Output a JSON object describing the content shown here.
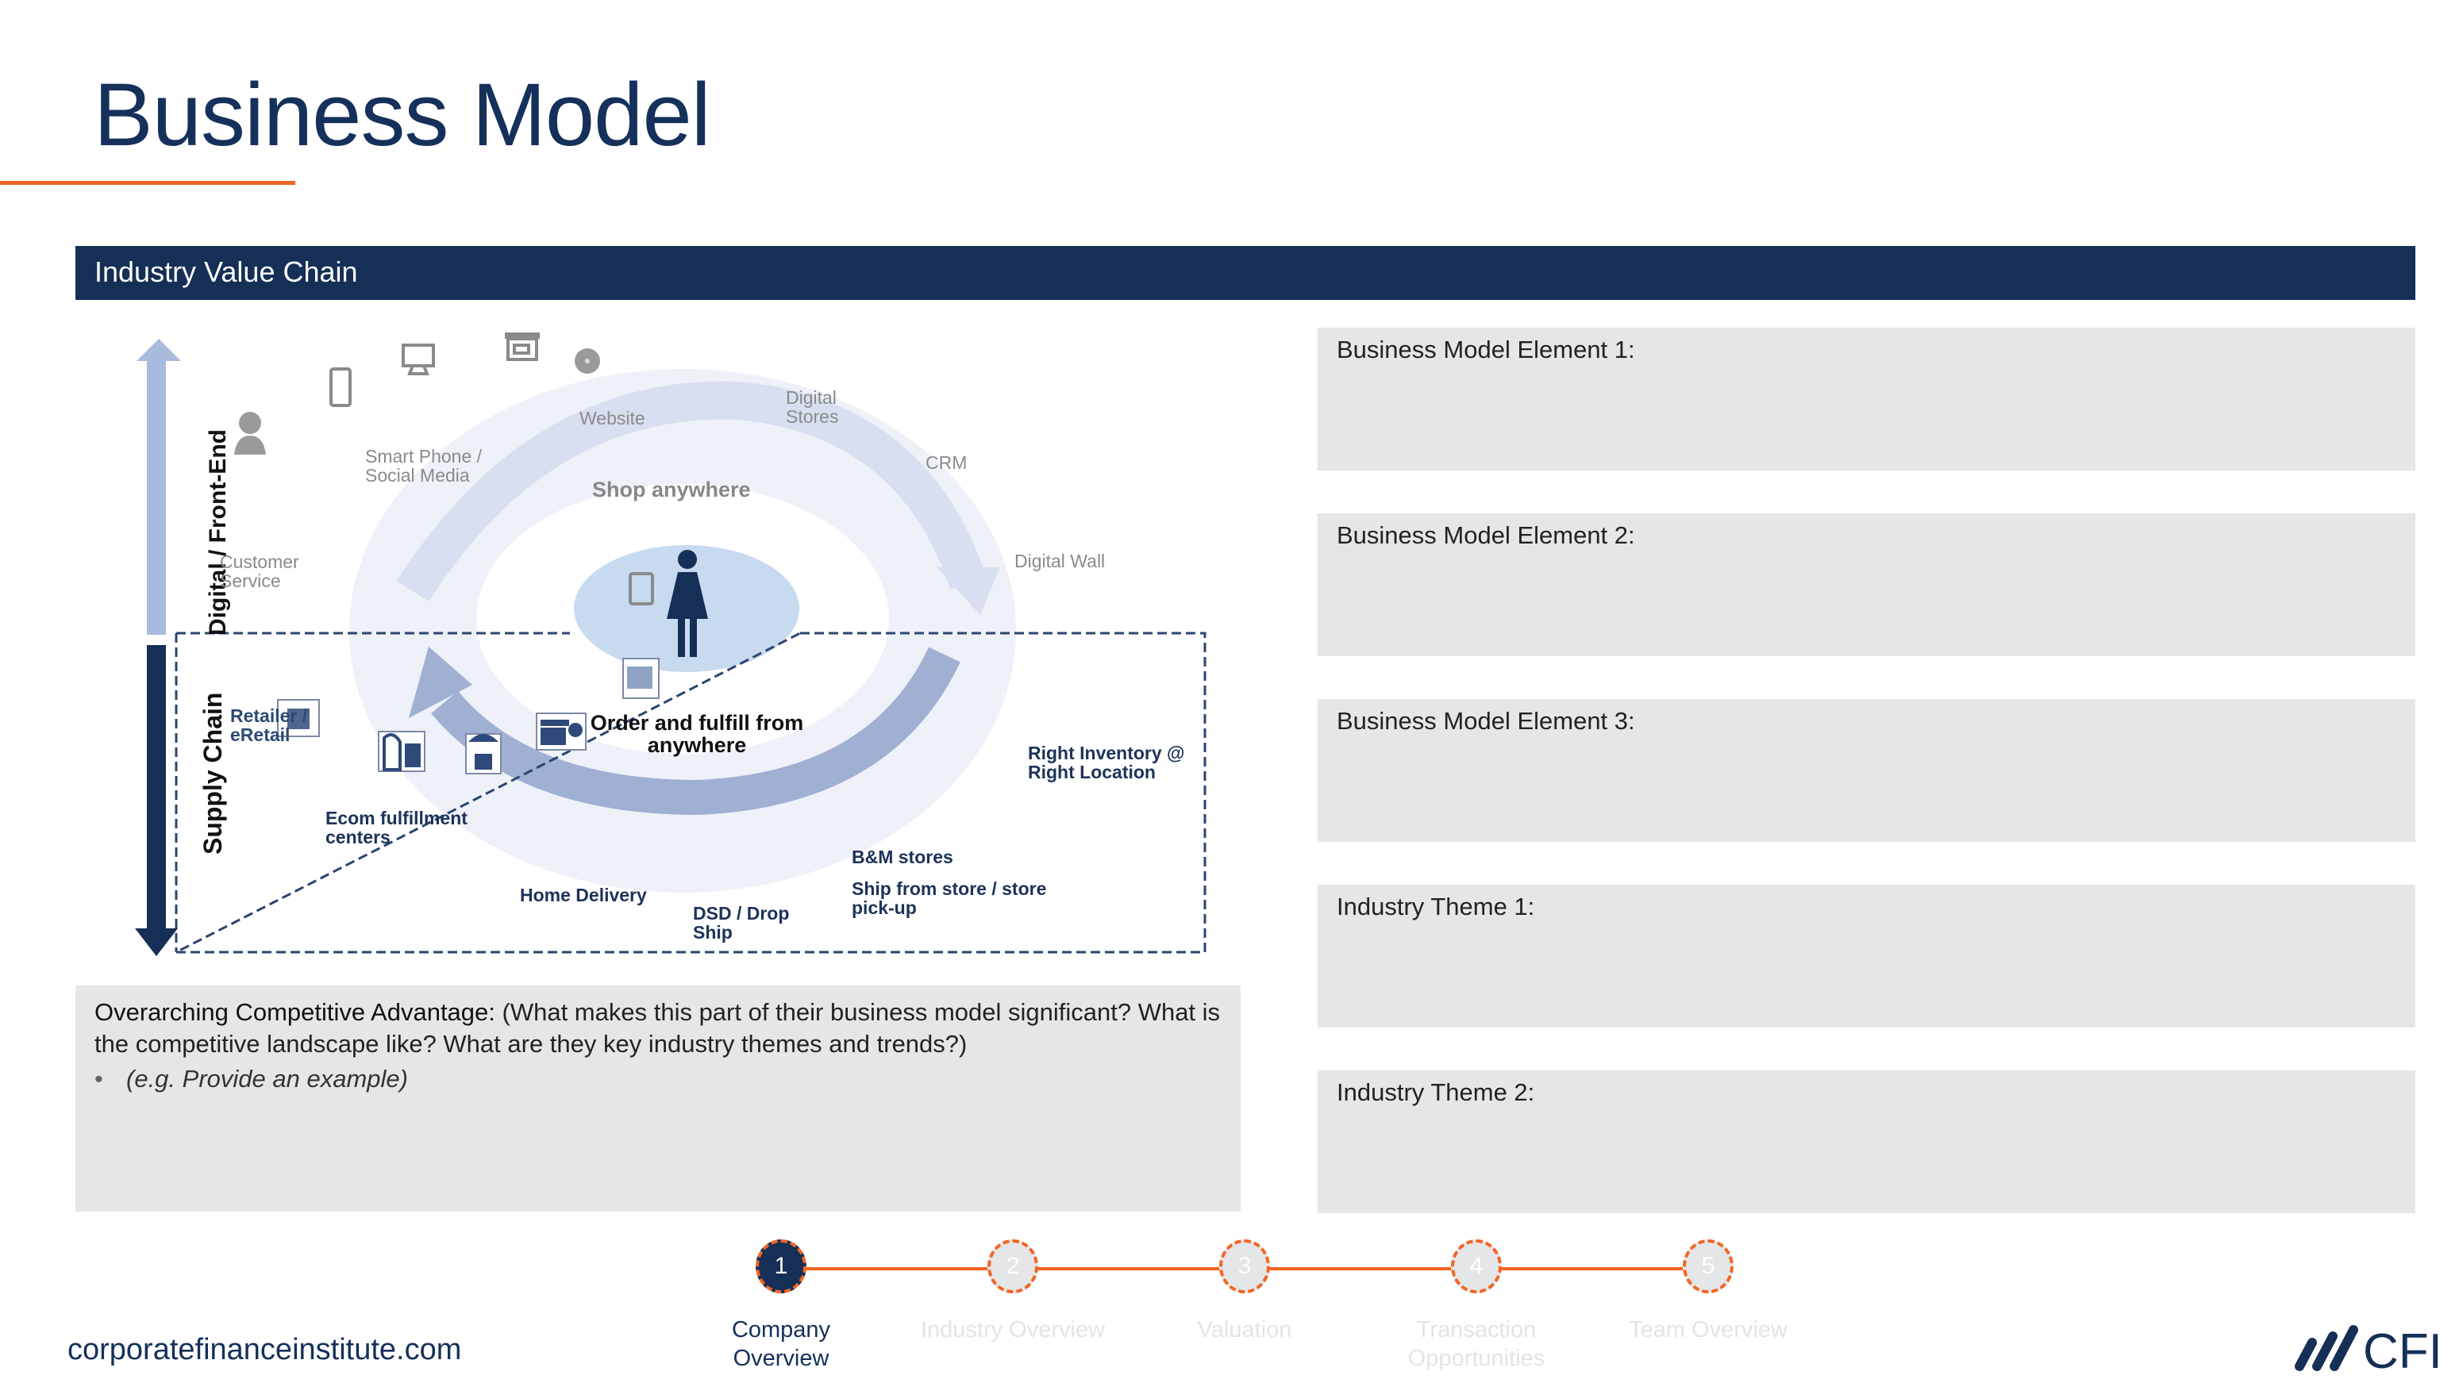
{
  "page": {
    "title": "Business Model",
    "section_header": "Industry Value Chain"
  },
  "diagram": {
    "axis_labels": {
      "top": "Digital / Front-End",
      "bottom": "Supply Chain"
    },
    "loop_labels": {
      "top": "Shop anywhere",
      "bottom": "Order and fulfill from anywhere"
    },
    "front_end_items": [
      {
        "label": "Customer Service",
        "icon": "customer-service-headset-icon"
      },
      {
        "label": "Smart Phone / Social Media",
        "icon": "smartphone-icon"
      },
      {
        "label": "Website",
        "icon": "desktop-monitor-icon"
      },
      {
        "label": "Digital Stores",
        "icon": "storefront-icon"
      },
      {
        "label": "CRM",
        "icon": "crm-disc-icon"
      },
      {
        "label": "Digital Wall",
        "icon": "touch-screen-icon"
      }
    ],
    "supply_chain_items": [
      {
        "label": "Retailer / eRetail",
        "icon": ""
      },
      {
        "label": "Ecom fulfillment centers",
        "icon": "open-box-icon"
      },
      {
        "label": "Home Delivery",
        "icon": "delivery-truck-icon"
      },
      {
        "label": "DSD / Drop Ship",
        "icon": "parachute-box-icon"
      },
      {
        "label": "B&M stores",
        "icon": "store-location-icon"
      },
      {
        "label": "Ship from store / store pick-up",
        "icon": ""
      },
      {
        "label": "Right Inventory @ Right Location",
        "icon": "inventory-boxes-icon"
      }
    ],
    "center_icon": "customer-person-icon",
    "colors": {
      "navy": "#152f56",
      "light_blue": "#c8daf0",
      "arc_blue": "#9fb0d3",
      "pale": "#eef1f8"
    }
  },
  "advantage": {
    "lead": "Overarching Competitive Advantage:",
    "text": " (What makes this part of their business model significant? What is the competitive landscape like? What are they key industry themes and trends?)",
    "bullet": "(e.g. Provide an example)"
  },
  "right_boxes": [
    {
      "label": "Business Model Element 1:"
    },
    {
      "label": "Business Model Element 2:"
    },
    {
      "label": "Business Model Element 3:"
    },
    {
      "label": "Industry Theme 1:"
    },
    {
      "label": "Industry Theme 2:"
    }
  ],
  "stepper": {
    "current_step": 1,
    "steps": [
      {
        "number": "1",
        "label": "Company Overview",
        "active": true
      },
      {
        "number": "2",
        "label": "Industry Overview",
        "active": false
      },
      {
        "number": "3",
        "label": "Valuation",
        "active": false
      },
      {
        "number": "4",
        "label": "Transaction Opportunities",
        "active": false
      },
      {
        "number": "5",
        "label": "Team Overview",
        "active": false
      }
    ]
  },
  "footer": {
    "url": "corporatefinanceinstitute.com",
    "logo_text": "CFI"
  },
  "colors": {
    "brand_navy": "#152f56",
    "accent_orange": "#f26522",
    "panel_gray": "#e5e6e8"
  }
}
